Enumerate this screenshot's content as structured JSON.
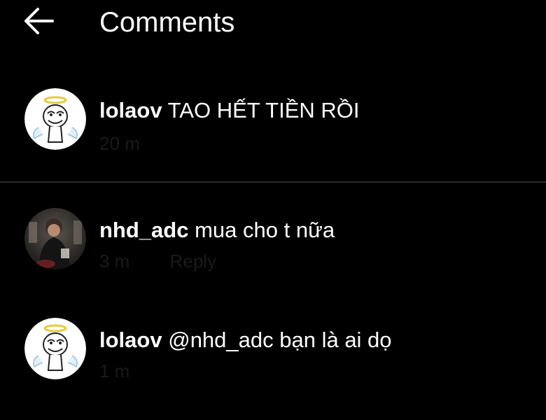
{
  "header": {
    "back_icon": "arrow-left-icon",
    "title": "Comments"
  },
  "comments": [
    {
      "username": "lolaov",
      "text": "TAO HẾT TIỀN RỒI",
      "time": "20 m",
      "avatar_icon": "angel-meme-face-avatar"
    },
    {
      "username": "nhd_adc",
      "text": "mua cho t nữa",
      "time": "3 m",
      "reply_label": "Reply",
      "avatar_icon": "person-photo-avatar"
    },
    {
      "username": "lolaov",
      "text": "@nhd_adc bạn là ai dọ",
      "time": "1 m",
      "avatar_icon": "angel-meme-face-avatar"
    }
  ],
  "colors": {
    "background": "#000000",
    "text": "#ffffff",
    "divider": "#2a2a2a",
    "meta": "#1a1a1a"
  }
}
